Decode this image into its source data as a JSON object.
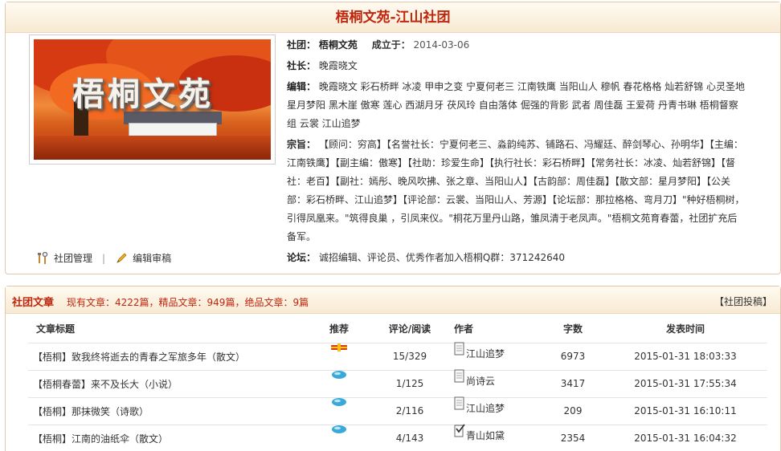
{
  "club": {
    "header_title": "梧桐文苑-江山社团",
    "banner_text": "梧桐文苑",
    "name_label": "社团：",
    "name": "梧桐文苑",
    "founded_label": "成立于：",
    "founded": "2014-03-06",
    "president_label": "社长：",
    "president": "晚霞晓文",
    "editors_label": "编辑：",
    "editors": "晚霞晓文 彩石桥畔 冰凌 甲申之变 宁夏何老三 江南铁鹰 当阳山人 穆帆 春花格格 灿若舒锦 心灵圣地 星月梦阳 黑木崖 傲寒 莲心 西湖月牙 茯风玲 自由落体 倔强的背影 武者 周佳磊 王爱荷 丹青书琳 梧桐督察组 云裳 江山追梦",
    "purpose_label": "宗旨：",
    "purpose": "【顾问：穷高】【名誉社长：宁夏何老三、淼韵纯苏、铺路石、冯耀廷、醉剑琴心、孙明华】【主编：江南铁鹰】【副主编：傲寒】【社助：珍爱生命】【执行社长：彩石桥畔】【常务社长：冰凌、灿若舒锦】【督社：老百】【副社：嫣彤、晚风吹拂、张之章、当阳山人】【古韵部：周佳磊】【散文部：星月梦阳】【公关部：彩石桥畔、江山追梦】【评论部：云裳、当阳山人、芳源】【论坛部：那拉格格、弯月刀】\"种好梧桐树，引得凤凰来。\"筑得良巢 ，引凤来仪。\"桐花万里丹山路，雏凤清于老凤声。\"梧桐文苑育春蕾，社团扩充后备军。",
    "forum_label": "论坛：",
    "forum": "诚招编辑、评论员、优秀作者加入梧桐Q群：371242640",
    "tools": {
      "manage_label": "社团管理",
      "separator": "|",
      "review_label": "编辑审稿"
    }
  },
  "articles": {
    "title": "社团文章",
    "stats": "现有文章：4222篇，精品文章：949篇，绝品文章：9篇",
    "submit_label": "【社团投稿】",
    "columns": {
      "title": "文章标题",
      "recommend": "推荐",
      "comments_reads": "评论/阅读",
      "author": "作者",
      "words": "字数",
      "published": "发表时间"
    },
    "rows": [
      {
        "title": "【梧桐】致我终将逝去的青春之军旅多年（散文）",
        "rec": "flag",
        "cr": "15/329",
        "author": "江山追梦",
        "icon": "document-icon",
        "words": "6973",
        "time": "2015-01-31 18:03:33"
      },
      {
        "title": "【梧桐春蕾】来不及长大（小说）",
        "rec": "gem",
        "cr": "1/125",
        "author": "尚诗云",
        "icon": "document-icon",
        "words": "3417",
        "time": "2015-01-31 17:55:34"
      },
      {
        "title": "【梧桐】那抹微笑（诗歌）",
        "rec": "gem",
        "cr": "2/116",
        "author": "江山追梦",
        "icon": "document-icon",
        "words": "209",
        "time": "2015-01-31 16:10:11"
      },
      {
        "title": "【梧桐】江南的油纸伞（散文）",
        "rec": "gem",
        "cr": "4/143",
        "author": "青山如黛",
        "icon": "checked-document-icon",
        "words": "2354",
        "time": "2015-01-31 16:04:32"
      }
    ]
  },
  "colors": {
    "accent": "#c0260c",
    "border": "#e0c8a8",
    "header_bg": "#f8ead3"
  }
}
